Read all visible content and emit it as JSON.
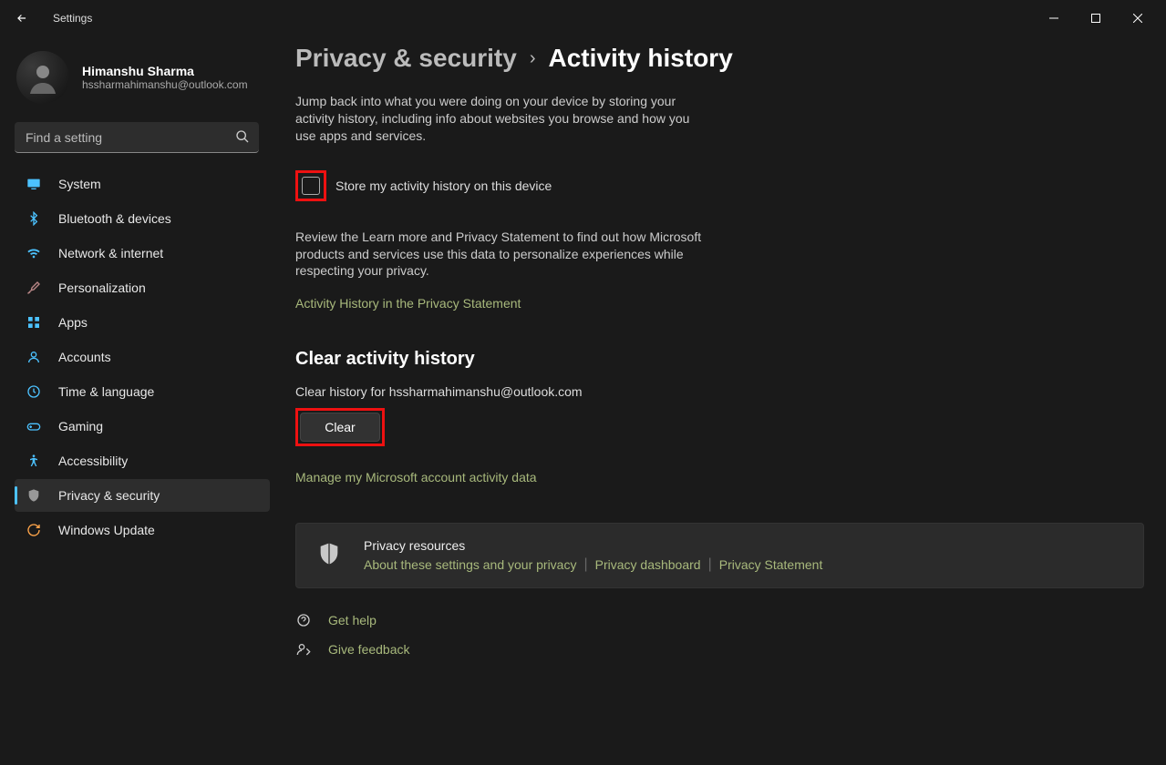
{
  "app_title": "Settings",
  "user": {
    "name": "Himanshu Sharma",
    "email": "hssharmahimanshu@outlook.com"
  },
  "search": {
    "placeholder": "Find a setting"
  },
  "nav": {
    "items": [
      {
        "label": "System"
      },
      {
        "label": "Bluetooth & devices"
      },
      {
        "label": "Network & internet"
      },
      {
        "label": "Personalization"
      },
      {
        "label": "Apps"
      },
      {
        "label": "Accounts"
      },
      {
        "label": "Time & language"
      },
      {
        "label": "Gaming"
      },
      {
        "label": "Accessibility"
      },
      {
        "label": "Privacy & security"
      },
      {
        "label": "Windows Update"
      }
    ]
  },
  "breadcrumb": {
    "parent": "Privacy & security",
    "current": "Activity history"
  },
  "content": {
    "intro": "Jump back into what you were doing on your device by storing your activity history, including info about websites you browse and how you use apps and services.",
    "checkbox_label": "Store my activity history on this device",
    "review": "Review the Learn more and Privacy Statement to find out how Microsoft products and services use this data to personalize experiences while respecting your privacy.",
    "privacy_link": "Activity History in the Privacy Statement",
    "clear_title": "Clear activity history",
    "clear_sub": "Clear history for hssharmahimanshu@outlook.com",
    "clear_btn": "Clear",
    "manage_link": "Manage my Microsoft account activity data"
  },
  "resources": {
    "title": "Privacy resources",
    "links": [
      "About these settings and your privacy",
      "Privacy dashboard",
      "Privacy Statement"
    ]
  },
  "footer": {
    "help": "Get help",
    "feedback": "Give feedback"
  }
}
